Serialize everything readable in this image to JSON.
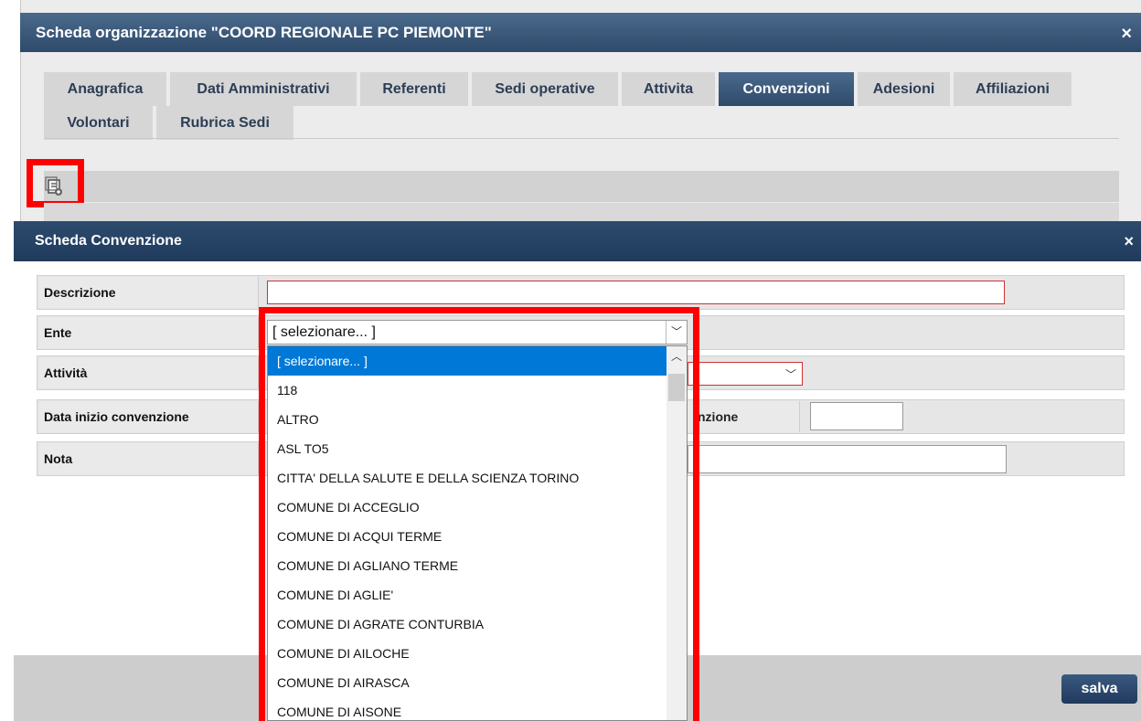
{
  "outer": {
    "title": "Scheda organizzazione \"COORD REGIONALE PC PIEMONTE\"",
    "close": "×",
    "tabs": [
      {
        "label": "Anagrafica"
      },
      {
        "label": "Dati Amministrativi"
      },
      {
        "label": "Referenti"
      },
      {
        "label": "Sedi operative"
      },
      {
        "label": "Attivita"
      },
      {
        "label": "Convenzioni",
        "active": true
      },
      {
        "label": "Adesioni"
      },
      {
        "label": "Affiliazioni"
      },
      {
        "label": "Volontari"
      },
      {
        "label": "Rubrica Sedi"
      }
    ],
    "add_icon": "add-document-icon"
  },
  "modal": {
    "title": "Scheda Convenzione",
    "close": "×",
    "fields": {
      "descrizione": "Descrizione",
      "ente": "Ente",
      "attivita": "Attività",
      "data_inizio": "Data inizio convenzione",
      "data_fine_partial": "nzione",
      "nota": "Nota"
    },
    "save": "salva"
  },
  "dropdown": {
    "selected": "[ selezionare... ]",
    "options": [
      "[ selezionare... ]",
      "118",
      "ALTRO",
      "ASL TO5",
      "CITTA' DELLA SALUTE E DELLA SCIENZA TORINO",
      "COMUNE DI ACCEGLIO",
      "COMUNE DI ACQUI TERME",
      "COMUNE DI AGLIANO TERME",
      "COMUNE DI AGLIE'",
      "COMUNE DI AGRATE CONTURBIA",
      "COMUNE DI AILOCHE",
      "COMUNE DI AIRASCA",
      "COMUNE DI AISONE"
    ]
  },
  "colors": {
    "accent": "#2e4a6b",
    "highlight": "#ff0000",
    "selection": "#0078d7"
  }
}
